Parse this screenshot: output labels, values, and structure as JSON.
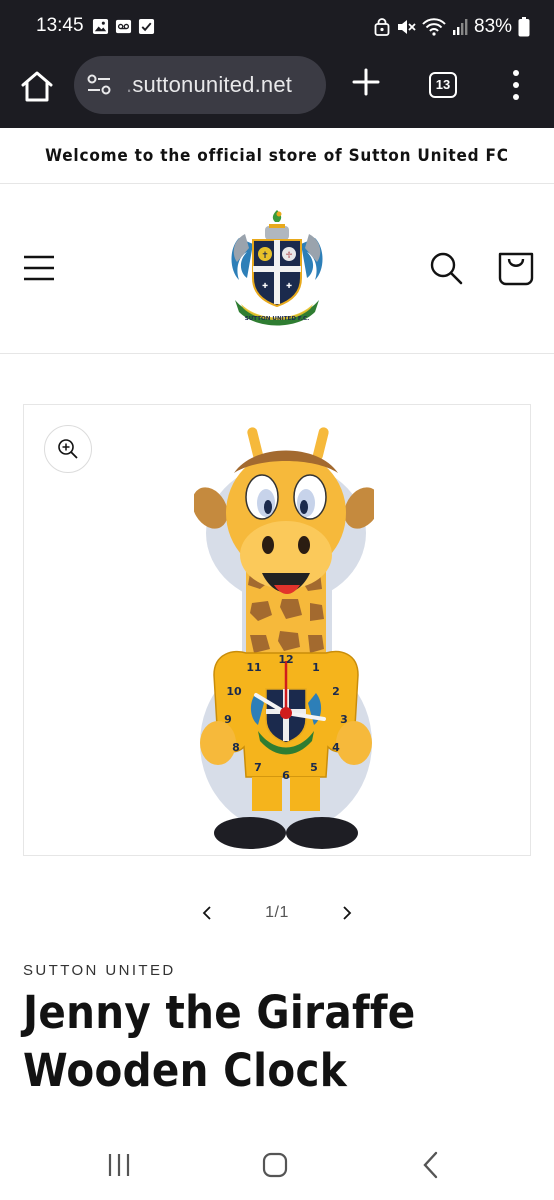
{
  "status_bar": {
    "time": "13:45",
    "battery": "83%",
    "left_icons": [
      "image-icon",
      "voicemail-icon",
      "checkbox-icon"
    ],
    "right_icons": [
      "app-lock-icon",
      "mute-icon",
      "wifi-icon",
      "signal-icon",
      "battery-icon"
    ]
  },
  "browser": {
    "url_prefix": ".",
    "url": "suttonunited.net",
    "tab_count": "13"
  },
  "announcement": {
    "text": "Welcome to the official store of Sutton United FC"
  },
  "header": {
    "logo_text": "SUTTON UNITED F.C."
  },
  "product": {
    "slider_counter": "1/1",
    "vendor": "SUTTON UNITED",
    "title": "Jenny the Giraffe Wooden Clock",
    "clock_numbers": [
      "12",
      "1",
      "2",
      "3",
      "4",
      "5",
      "6",
      "7",
      "8",
      "9",
      "10",
      "11"
    ]
  },
  "colors": {
    "status_bar_bg": "#1c1c22",
    "url_box_bg": "#3b3b44",
    "giraffe_yellow": "#f6b93b",
    "giraffe_spots": "#a36a2f",
    "crest_navy": "#1b2a4d",
    "crest_green": "#2f7d32"
  }
}
